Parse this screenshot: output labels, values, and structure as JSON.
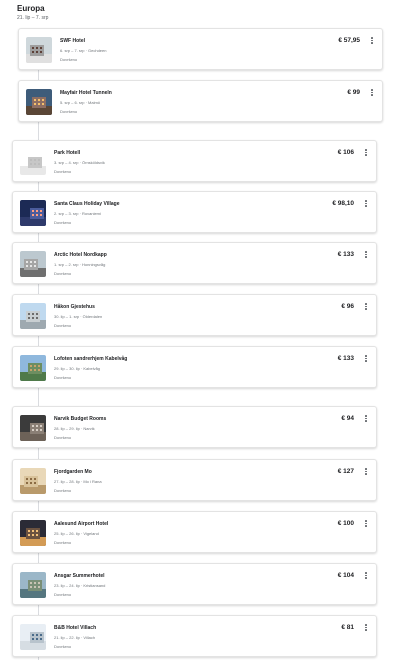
{
  "trip": {
    "title": "Europa",
    "dates": "21. lip – 7. srp"
  },
  "hotels": [
    {
      "name": "SWF Hotel",
      "dates": "6. srp – 7. srp · Gechdeen",
      "status": "Dovršeno",
      "price": "€ 57,95",
      "thumb": "swf-hotel-photo"
    },
    {
      "name": "Mayfair Hotel Tunneln",
      "dates": "5. srp – 6. srp · Malmö",
      "status": "Dovršeno",
      "price": "€ 99",
      "thumb": "mayfair-hotel-photo"
    },
    {
      "name": "Park Hotell",
      "dates": "3. srp – 4. srp · Örnsköldsvik",
      "status": "Dovršeno",
      "price": "€ 106",
      "thumb": "park-hotell-photo"
    },
    {
      "name": "Santa Claus Holiday Village",
      "dates": "2. srp – 3. srp · Rovaniemi",
      "status": "Dovršeno",
      "price": "€ 98,10",
      "thumb": "santa-claus-village-photo"
    },
    {
      "name": "Arctic Hotel Nordkapp",
      "dates": "1. srp – 2. srp · Honningsvåg",
      "status": "Dovršeno",
      "price": "€ 133",
      "thumb": "arctic-hotel-photo"
    },
    {
      "name": "Håkon Gjestehus",
      "dates": "30. lip – 1. srp · Ölderdalen",
      "status": "Dovršeno",
      "price": "€ 96",
      "thumb": "hakon-gjestehus-photo"
    },
    {
      "name": "Lofoten sandrerhjem Kabelvåg",
      "dates": "29. lip – 30. lip · Kabelvåg",
      "status": "Dovršeno",
      "price": "€ 133",
      "thumb": "lofoten-photo"
    },
    {
      "name": "Narvik Budget Rooms",
      "dates": "28. lip – 29. lip · Narvik",
      "status": "Dovršeno",
      "price": "€ 94",
      "thumb": "narvik-rooms-photo"
    },
    {
      "name": "Fjordgarden Mo",
      "dates": "27. lip – 28. lip · Mo i Rana",
      "status": "Dovršeno",
      "price": "€ 127",
      "thumb": "fjordgarden-photo"
    },
    {
      "name": "Aalesund Airport Hotel",
      "dates": "25. lip – 26. lip · Vigeland",
      "status": "Dovršeno",
      "price": "€ 100",
      "thumb": "aalesund-hotel-photo"
    },
    {
      "name": "Ansgar Summerhotel",
      "dates": "23. lip – 24. lip · Kristiansand",
      "status": "Dovršeno",
      "price": "€ 104",
      "thumb": "ansgar-hotel-photo"
    },
    {
      "name": "B&B Hotel Villach",
      "dates": "21. lip – 22. lip · Villach",
      "status": "Dovršeno",
      "price": "€ 81",
      "thumb": "bb-villach-photo"
    }
  ]
}
